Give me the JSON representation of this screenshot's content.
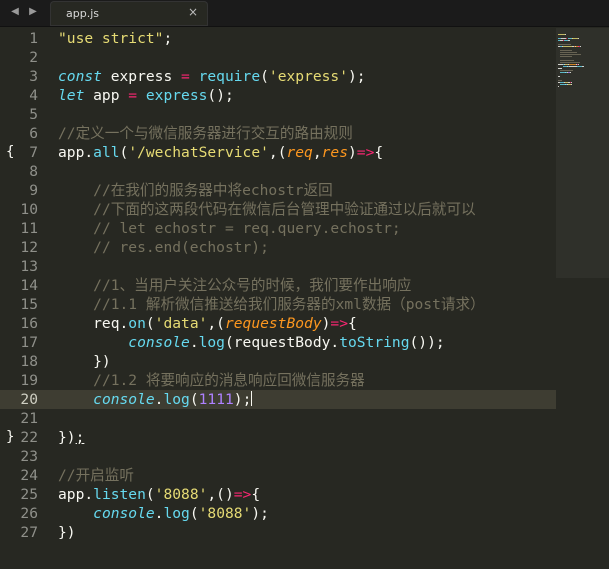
{
  "tabs": [
    {
      "title": "app.js",
      "close": "×"
    }
  ],
  "nav": {
    "back": "◀",
    "forward": "▶"
  },
  "current_line": 20,
  "lines": [
    {
      "n": "1",
      "fold": "",
      "tokens": [
        [
          "s",
          "\"use strict\""
        ],
        [
          "",
          ";"
        ]
      ]
    },
    {
      "n": "2",
      "fold": "",
      "tokens": []
    },
    {
      "n": "3",
      "fold": "",
      "tokens": [
        [
          "k",
          "const"
        ],
        [
          "",
          " express "
        ],
        [
          "op",
          "="
        ],
        [
          "",
          " "
        ],
        [
          "f",
          "require"
        ],
        [
          "",
          "("
        ],
        [
          "s",
          "'express'"
        ],
        [
          "",
          ");"
        ]
      ]
    },
    {
      "n": "4",
      "fold": "",
      "tokens": [
        [
          "k",
          "let"
        ],
        [
          "",
          " app "
        ],
        [
          "op",
          "="
        ],
        [
          "",
          " "
        ],
        [
          "f",
          "express"
        ],
        [
          "",
          "();"
        ]
      ]
    },
    {
      "n": "5",
      "fold": "",
      "tokens": []
    },
    {
      "n": "6",
      "fold": "",
      "tokens": [
        [
          "c",
          "//定义一个与微信服务器进行交互的路由规则"
        ]
      ]
    },
    {
      "n": "7",
      "fold": "{",
      "tokens": [
        [
          "",
          "app."
        ],
        [
          "f",
          "all"
        ],
        [
          "",
          "("
        ],
        [
          "s",
          "'/wechatService'"
        ],
        [
          "",
          ",("
        ],
        [
          "p",
          "req"
        ],
        [
          "",
          ","
        ],
        [
          "p",
          "res"
        ],
        [
          "",
          ")"
        ],
        [
          "op",
          "=>"
        ],
        [
          "",
          "{"
        ]
      ]
    },
    {
      "n": "8",
      "fold": "",
      "tokens": []
    },
    {
      "n": "9",
      "fold": "",
      "tokens": [
        [
          "",
          "    "
        ],
        [
          "c",
          "//在我们的服务器中将echostr返回"
        ]
      ]
    },
    {
      "n": "10",
      "fold": "",
      "tokens": [
        [
          "",
          "    "
        ],
        [
          "c",
          "//下面的这两段代码在微信后台管理中验证通过以后就可以"
        ]
      ]
    },
    {
      "n": "11",
      "fold": "",
      "tokens": [
        [
          "",
          "    "
        ],
        [
          "c",
          "// let echostr = req.query.echostr;"
        ]
      ]
    },
    {
      "n": "12",
      "fold": "",
      "tokens": [
        [
          "",
          "    "
        ],
        [
          "c",
          "// res.end(echostr);"
        ]
      ]
    },
    {
      "n": "13",
      "fold": "",
      "tokens": []
    },
    {
      "n": "14",
      "fold": "",
      "tokens": [
        [
          "",
          "    "
        ],
        [
          "c",
          "//1、当用户关注公众号的时候，我们要作出响应"
        ]
      ]
    },
    {
      "n": "15",
      "fold": "",
      "tokens": [
        [
          "",
          "    "
        ],
        [
          "c",
          "//1.1 解析微信推送给我们服务器的xml数据（post请求）"
        ]
      ]
    },
    {
      "n": "16",
      "fold": "",
      "tokens": [
        [
          "",
          "    req."
        ],
        [
          "f",
          "on"
        ],
        [
          "",
          "("
        ],
        [
          "s",
          "'data'"
        ],
        [
          "",
          ",("
        ],
        [
          "p",
          "requestBody"
        ],
        [
          "",
          ")"
        ],
        [
          "op",
          "=>"
        ],
        [
          "",
          "{"
        ]
      ]
    },
    {
      "n": "17",
      "fold": "",
      "tokens": [
        [
          "",
          "        "
        ],
        [
          "k",
          "console"
        ],
        [
          "",
          "."
        ],
        [
          "f",
          "log"
        ],
        [
          "",
          "(requestBody."
        ],
        [
          "f",
          "toString"
        ],
        [
          "",
          "());"
        ]
      ]
    },
    {
      "n": "18",
      "fold": "",
      "tokens": [
        [
          "",
          "    })"
        ]
      ]
    },
    {
      "n": "19",
      "fold": "",
      "tokens": [
        [
          "",
          "    "
        ],
        [
          "c",
          "//1.2 将要响应的消息响应回微信服务器"
        ]
      ]
    },
    {
      "n": "20",
      "fold": "",
      "tokens": [
        [
          "",
          "    "
        ],
        [
          "k",
          "console"
        ],
        [
          "",
          "."
        ],
        [
          "f",
          "log"
        ],
        [
          "",
          "("
        ],
        [
          "n",
          "1111"
        ],
        [
          "",
          ");"
        ],
        [
          "cursor",
          ""
        ]
      ]
    },
    {
      "n": "21",
      "fold": "",
      "tokens": []
    },
    {
      "n": "22",
      "fold": "}",
      "tokens": [
        [
          "",
          "})"
        ],
        [
          "u",
          ";"
        ]
      ]
    },
    {
      "n": "23",
      "fold": "",
      "tokens": []
    },
    {
      "n": "24",
      "fold": "",
      "tokens": [
        [
          "c",
          "//开启监听"
        ]
      ]
    },
    {
      "n": "25",
      "fold": "",
      "tokens": [
        [
          "",
          "app."
        ],
        [
          "f",
          "listen"
        ],
        [
          "",
          "("
        ],
        [
          "s",
          "'8088'"
        ],
        [
          "",
          ",()"
        ],
        [
          "op",
          "=>"
        ],
        [
          "",
          "{"
        ]
      ]
    },
    {
      "n": "26",
      "fold": "",
      "tokens": [
        [
          "",
          "    "
        ],
        [
          "k",
          "console"
        ],
        [
          "",
          "."
        ],
        [
          "f",
          "log"
        ],
        [
          "",
          "("
        ],
        [
          "s",
          "'8088'"
        ],
        [
          "",
          ");"
        ]
      ]
    },
    {
      "n": "27",
      "fold": "",
      "tokens": [
        [
          "",
          "})"
        ]
      ]
    }
  ],
  "colors": {
    "background": "#272822",
    "keyword": "#66d9ef",
    "string": "#e6db74",
    "operator": "#f92672",
    "param": "#fd971f",
    "comment": "#75715e",
    "number": "#ae81ff",
    "current_line": "#3e3d32"
  }
}
